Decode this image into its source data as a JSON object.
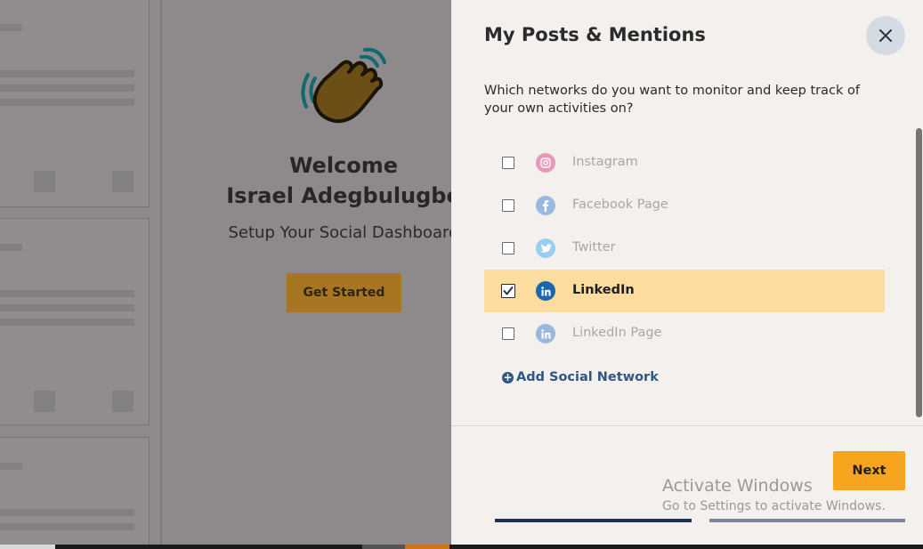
{
  "welcome": {
    "title_line1": "Welcome",
    "title_line2": "Israel Adegbulugbe",
    "subtitle": "Setup Your Social Dashboard",
    "button_label": "Get Started"
  },
  "panel": {
    "title": "My Posts & Mentions",
    "prompt": "Which networks do you want to monitor and keep track of your own activities on?",
    "networks": [
      {
        "label": "Instagram",
        "icon": "instagram-icon",
        "checked": false,
        "color": "#e899b8"
      },
      {
        "label": "Facebook Page",
        "icon": "facebook-icon",
        "checked": false,
        "color": "#9bb8e3"
      },
      {
        "label": "Twitter",
        "icon": "twitter-icon",
        "checked": false,
        "color": "#99cfee"
      },
      {
        "label": "LinkedIn",
        "icon": "linkedin-icon",
        "checked": true,
        "color": "#1a67b0"
      },
      {
        "label": "LinkedIn Page",
        "icon": "linkedin-icon",
        "checked": false,
        "color": "#9ab7dc"
      }
    ],
    "add_network_label": "Add Social Network",
    "next_label": "Next",
    "progress_steps": 2,
    "current_step": 1
  },
  "watermark": {
    "line1": "Activate Windows",
    "line2": "Go to Settings to activate Windows."
  },
  "colors": {
    "accent": "#f7a51f",
    "selected_row": "#fcdc9f",
    "link": "#2e5783"
  }
}
